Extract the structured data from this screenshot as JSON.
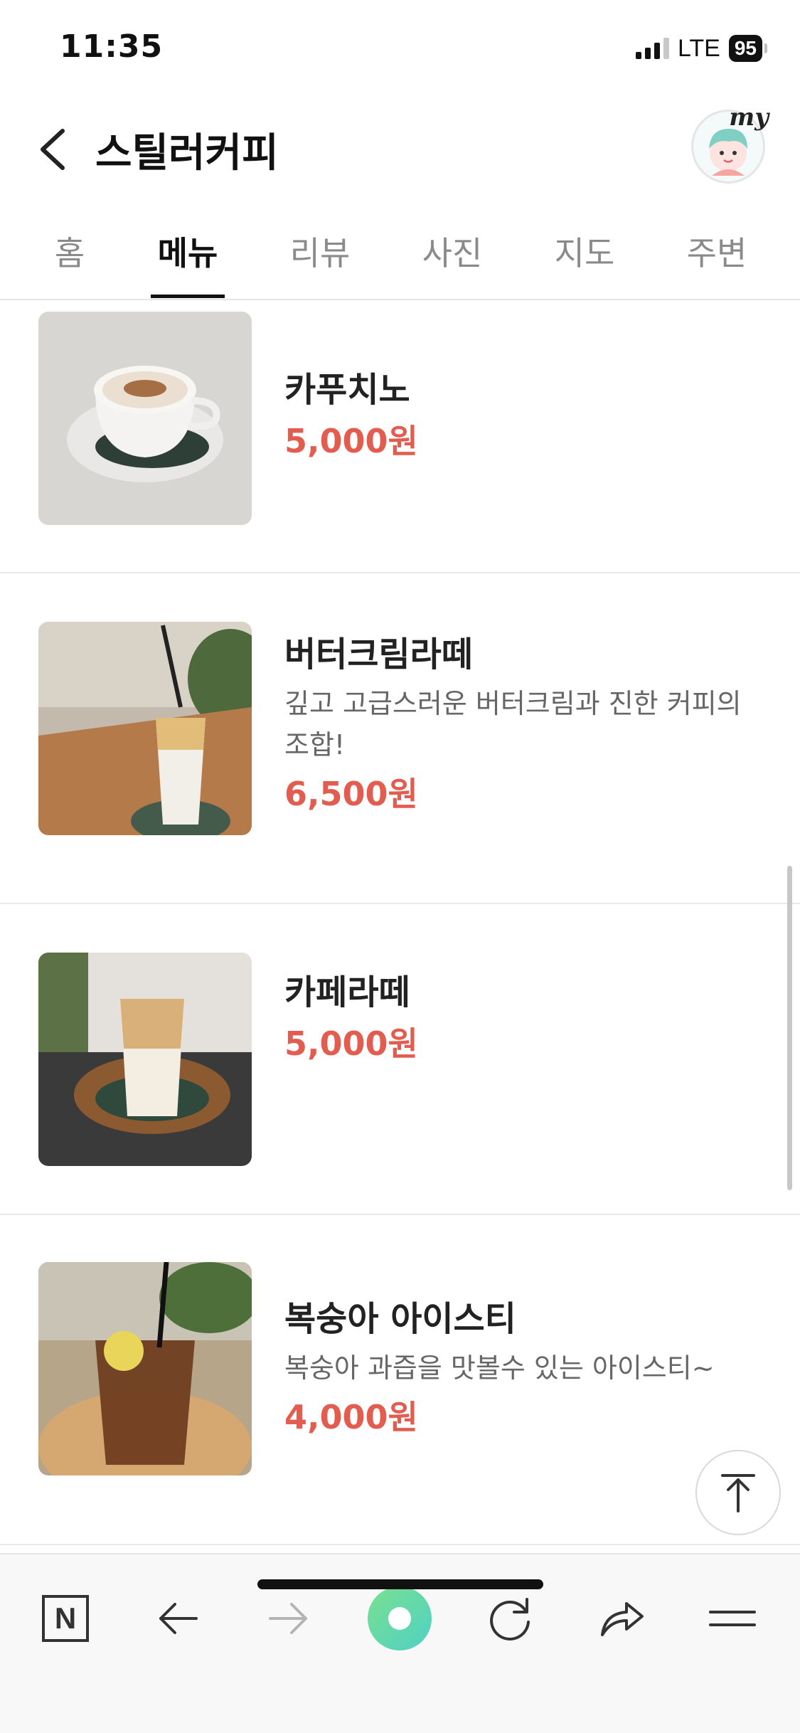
{
  "status_bar": {
    "time": "11:35",
    "network": "LTE",
    "battery": "95"
  },
  "header": {
    "title": "스틸러커피",
    "avatar_label": "my"
  },
  "tabs": [
    {
      "label": "홈",
      "active": false
    },
    {
      "label": "메뉴",
      "active": true
    },
    {
      "label": "리뷰",
      "active": false
    },
    {
      "label": "사진",
      "active": false
    },
    {
      "label": "지도",
      "active": false
    },
    {
      "label": "주변",
      "active": false
    }
  ],
  "menu": [
    {
      "name": "카푸치노",
      "desc": "",
      "price": "5,000원"
    },
    {
      "name": "버터크림라떼",
      "desc": "깊고 고급스러운 버터크림과 진한 커피의 조합!",
      "price": "6,500원"
    },
    {
      "name": "카페라떼",
      "desc": "",
      "price": "5,000원"
    },
    {
      "name": "복숭아 아이스티",
      "desc": "복숭아 과즙을 맛볼수 있는 아이스티~",
      "price": "4,000원"
    }
  ],
  "toolbar": {
    "icons": [
      "naver-home-icon",
      "back-arrow-icon",
      "forward-arrow-icon",
      "green-dot-icon",
      "refresh-icon",
      "share-icon",
      "menu-icon"
    ],
    "home_label": "N"
  },
  "colors": {
    "price": "#e25d4f",
    "active_tab": "#111111",
    "inactive_tab": "#8a8a8a"
  }
}
